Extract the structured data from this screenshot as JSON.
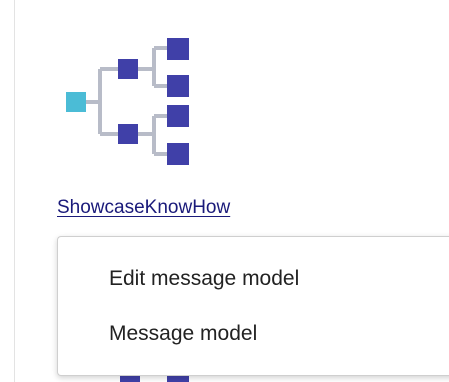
{
  "model": {
    "icon": "tree-structure-icon",
    "link_label": "ShowcaseKnowHow"
  },
  "context_menu": {
    "items": [
      {
        "label": "Edit message model"
      },
      {
        "label": "Message model"
      }
    ]
  },
  "colors": {
    "root_node": "#4bbcd6",
    "child_node": "#4040a8",
    "connector": "#b8bcc8",
    "link_text": "#1a1a7a"
  }
}
